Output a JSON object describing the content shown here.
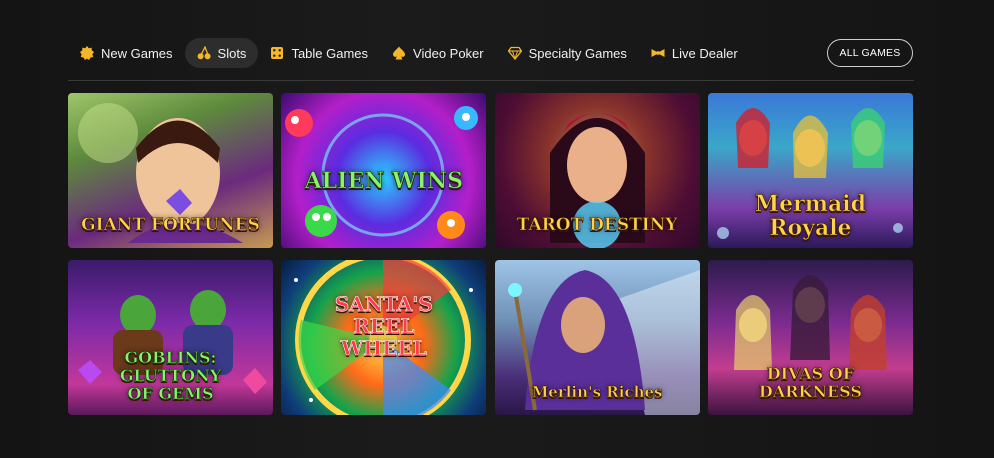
{
  "nav": {
    "items": [
      {
        "label": "New Games",
        "icon": "new-games-badge-icon",
        "active": false
      },
      {
        "label": "Slots",
        "icon": "cherries-icon",
        "active": true
      },
      {
        "label": "Table Games",
        "icon": "dice-icon",
        "active": false
      },
      {
        "label": "Video Poker",
        "icon": "spade-icon",
        "active": false
      },
      {
        "label": "Specialty Games",
        "icon": "diamond-icon",
        "active": false
      },
      {
        "label": "Live Dealer",
        "icon": "bowtie-icon",
        "active": false
      }
    ],
    "all_games_label": "ALL GAMES"
  },
  "games": [
    {
      "title": "GIANT FORTUNES"
    },
    {
      "title": "ALIEN WINS"
    },
    {
      "title": "TAROT DESTINY"
    },
    {
      "title": "Mermaid Royale"
    },
    {
      "title": "GOBLINS: GLUTTONY OF GEMS"
    },
    {
      "title": "SANTA'S REEL WHEEL"
    },
    {
      "title": "Merlin's Riches"
    },
    {
      "title": "DIVAS OF DARKNESS"
    }
  ],
  "colors": {
    "background": "#161616",
    "active_pill": "#2d2d2d",
    "nav_icon": "#f5b62a"
  }
}
